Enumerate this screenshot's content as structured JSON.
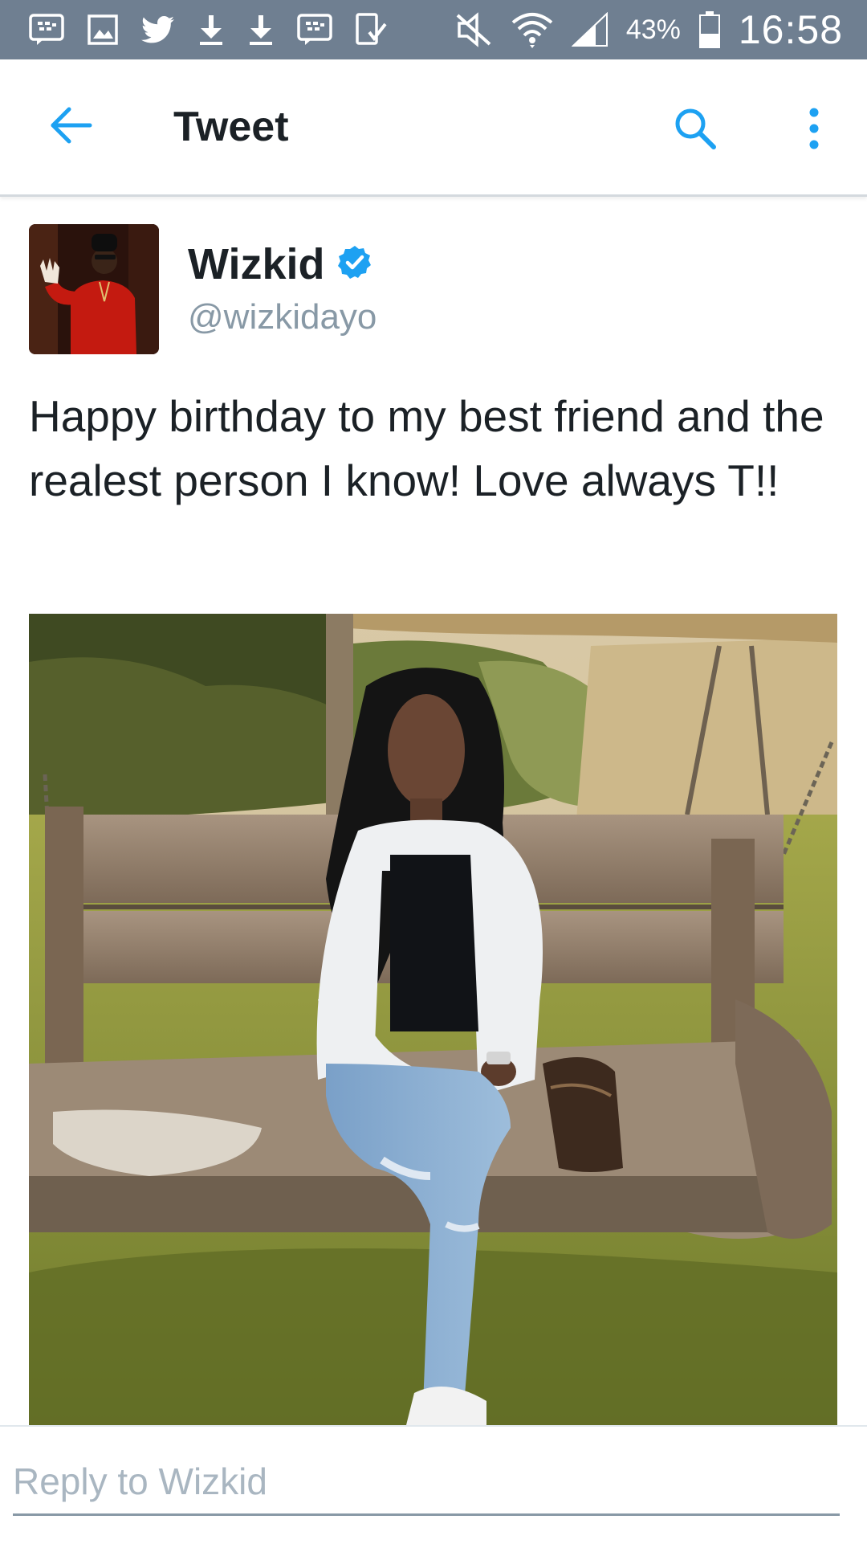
{
  "status_bar": {
    "battery_percent": "43%",
    "time": "16:58",
    "icons_left": [
      "bbm-icon",
      "gallery-icon",
      "twitter-bird-icon",
      "download-icon",
      "download-icon",
      "bbm-icon",
      "screen-mirror-icon"
    ],
    "icons_right": [
      "mute-icon",
      "wifi-icon",
      "signal-icon",
      "battery-icon"
    ]
  },
  "app_bar": {
    "title": "Tweet",
    "back_icon": "arrow-left-icon",
    "search_icon": "search-icon",
    "overflow_icon": "more-vertical-icon"
  },
  "tweet": {
    "author_name": "Wizkid",
    "verified": true,
    "author_handle": "@wizkidayo",
    "text": "Happy birthday to my best friend and the realest person I know! Love always T!!"
  },
  "reply": {
    "placeholder": "Reply to Wizkid"
  },
  "colors": {
    "status_bar": "#6f7f91",
    "accent": "#1da1f2",
    "text_primary": "#1b2126",
    "text_secondary": "#8899a6"
  }
}
